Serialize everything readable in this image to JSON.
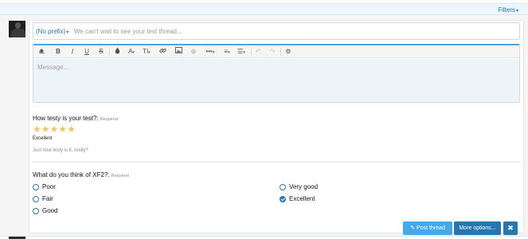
{
  "header": {
    "filters_label": "Filters",
    "filters_caret": "▾"
  },
  "thread_form": {
    "prefix_label": "(No prefix)",
    "prefix_caret": "▾",
    "title_placeholder": "We can't wait to see your test thread...",
    "title_value": ""
  },
  "editor": {
    "message_placeholder": "Message...",
    "message_value": "",
    "toolbar": [
      {
        "icon": "eraser-icon",
        "glyph": "⌫",
        "name": "remove-formatting"
      },
      {
        "icon": "bold-icon",
        "glyph": "B",
        "name": "bold"
      },
      {
        "icon": "italic-icon",
        "glyph": "I",
        "name": "italic"
      },
      {
        "icon": "underline-icon",
        "glyph": "U",
        "name": "underline"
      },
      {
        "icon": "strikethrough-icon",
        "glyph": "S",
        "name": "strikethrough"
      },
      {
        "icon": "text-color-icon",
        "glyph": "●",
        "name": "text-color"
      },
      {
        "icon": "font-family-icon",
        "glyph": "A",
        "name": "font-family"
      },
      {
        "icon": "font-size-icon",
        "glyph": "TI",
        "name": "font-size"
      },
      {
        "icon": "link-icon",
        "glyph": "🔗",
        "name": "link"
      },
      {
        "icon": "image-icon",
        "glyph": "▣",
        "name": "image"
      },
      {
        "icon": "smilie-icon",
        "glyph": "☺",
        "name": "smilies"
      },
      {
        "icon": "more-icon",
        "glyph": "•••",
        "name": "more"
      },
      {
        "icon": "align-icon",
        "glyph": "≡",
        "name": "align"
      },
      {
        "icon": "list-icon",
        "glyph": "☰",
        "name": "list"
      },
      {
        "icon": "undo-icon",
        "glyph": "↶",
        "name": "undo"
      },
      {
        "icon": "redo-icon",
        "glyph": "↷",
        "name": "redo"
      },
      {
        "icon": "settings-gear-icon",
        "glyph": "⚙",
        "name": "settings"
      }
    ]
  },
  "rating_field": {
    "question": "How testy is your test?:",
    "required_label": "Required",
    "stars": 5,
    "max_stars": 5,
    "rating_text": "Excellent",
    "hint": "Just how testy is it, really?",
    "star_color": "#f0c36a"
  },
  "choice_field": {
    "question": "What do you think of XF2?:",
    "required_label": "Required",
    "options": [
      {
        "label": "Poor",
        "checked": false
      },
      {
        "label": "Fair",
        "checked": false
      },
      {
        "label": "Good",
        "checked": false
      },
      {
        "label": "Very good",
        "checked": false
      },
      {
        "label": "Excellent",
        "checked": true
      }
    ]
  },
  "actions": {
    "post_label": "Post thread",
    "more_label": "More options...",
    "close_glyph": "✖"
  },
  "colors": {
    "accent": "#2577b1",
    "accent_light": "#47a7eb",
    "panel_bg": "#f5f5f5"
  }
}
